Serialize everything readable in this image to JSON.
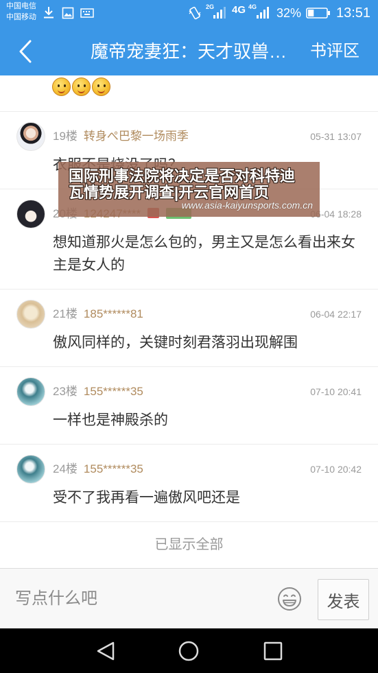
{
  "status_bar": {
    "carrier_top": "中国电信",
    "carrier_bottom": "中国移动",
    "sim1_network": "2G",
    "data_network": "4G",
    "sim2_network": "4G",
    "sim1_signal_bars": 3,
    "sim2_signal_bars": 4,
    "battery": "32%",
    "time": "13:51",
    "icons": {
      "download": "download-icon",
      "gallery": "image-icon",
      "keyboard": "keyboard-icon",
      "vibrate": "vibrate-icon",
      "signal": "signal-icon",
      "battery": "battery-icon"
    }
  },
  "header": {
    "back_icon": "back-arrow-icon",
    "title": "魔帝宠妻狂：天才驭兽…",
    "review_label": "书评区"
  },
  "previous_comment": {
    "emojis": [
      "emoji-icon",
      "emoji-icon",
      "emoji-icon"
    ]
  },
  "comments": [
    {
      "floor": "19楼",
      "user": "转身ぺ巴黎一场雨季",
      "date": "05-31 13:07",
      "text": "衣服不是烧没了吗？"
    },
    {
      "floor": "20楼",
      "user": "124247****",
      "date": "06-04 18:28",
      "text": "想知道那火是怎么包的，男主又是怎么看出来女主是女人的",
      "badges": [
        {
          "icon": "vip-badge-icon",
          "color": "#d9534f"
        },
        {
          "icon": "level-badge-icon",
          "color": "#6cc070"
        }
      ]
    },
    {
      "floor": "21楼",
      "user": "185******81",
      "date": "06-04 22:17",
      "text": "傲风同样的，关键时刻君落羽出现解围"
    },
    {
      "floor": "23楼",
      "user": "155******35",
      "date": "07-10 20:41",
      "text": "一样也是神殿杀的"
    },
    {
      "floor": "24楼",
      "user": "155******35",
      "date": "07-10 20:42",
      "text": "受不了我再看一遍傲风吧还是"
    }
  ],
  "list_end_label": "已显示全部",
  "composer": {
    "placeholder": "写点什么吧",
    "emoji_icon": "smiley-icon",
    "send_label": "发表"
  },
  "watermark": {
    "lines": [
      "国际刑事法院将决定是否对科特迪",
      "瓦情势展开调查|开云官网首页"
    ],
    "url": "www.asia-kaiyunsports.com.cn"
  },
  "nav_bar": {
    "back_icon": "back-triangle-icon",
    "home_icon": "home-circle-icon",
    "recents_icon": "recents-square-icon"
  },
  "colors": {
    "header_bg": "#3b97e7",
    "username": "#b08b5e",
    "meta_gray": "#9a9a9a",
    "text": "#333333",
    "divider": "#ececec",
    "nav_bg": "#000000"
  }
}
